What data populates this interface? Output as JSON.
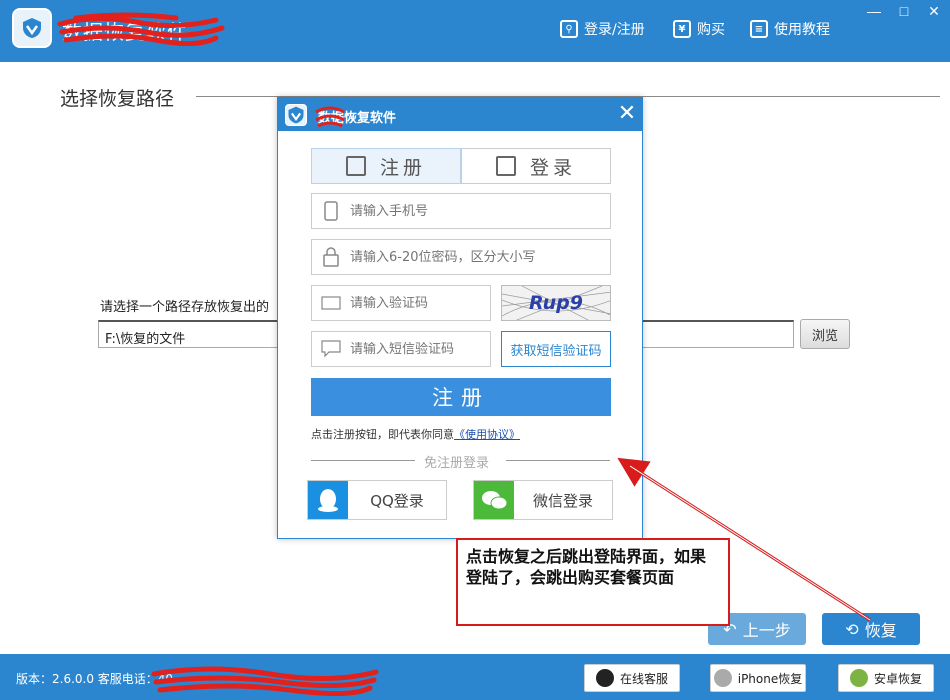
{
  "header": {
    "app_title": "数据恢复软件",
    "links": [
      {
        "label": "登录/注册",
        "icon": "user-key-icon"
      },
      {
        "label": "购买",
        "icon": "yen-icon"
      },
      {
        "label": "使用教程",
        "icon": "book-icon"
      }
    ],
    "window_controls": [
      "—",
      "□",
      "✕"
    ]
  },
  "main": {
    "section_title": "选择恢复路径",
    "path_label": "请选择一个路径存放恢复出的",
    "path_value": "F:\\恢复的文件",
    "browse_label": "浏览",
    "prev_label": "上一步",
    "recover_label": "恢复"
  },
  "footer": {
    "version_text": "版本：2.6.0.0 客服电话：40",
    "buttons": [
      {
        "label": "在线客服",
        "icon": "qq-icon"
      },
      {
        "label": "iPhone恢复",
        "icon": "apple-icon"
      },
      {
        "label": "安卓恢复",
        "icon": "android-icon"
      }
    ]
  },
  "dialog": {
    "title": "数据恢复软件",
    "tabs": [
      {
        "label": "注册",
        "icon": "edit-icon",
        "active": true
      },
      {
        "label": "登录",
        "icon": "login-icon",
        "active": false
      }
    ],
    "phone_placeholder": "请输入手机号",
    "password_placeholder": "请输入6-20位密码，区分大小写",
    "captcha_placeholder": "请输入验证码",
    "captcha_text": "Rup9",
    "sms_placeholder": "请输入短信验证码",
    "sms_button": "获取短信验证码",
    "register_button": "注册",
    "agreement_prefix": "点击注册按钮，即代表你同意",
    "agreement_link": "《使用协议》",
    "divider_text": "免注册登录",
    "qq_login": "QQ登录",
    "wechat_login": "微信登录"
  },
  "annotation": {
    "text": "点击恢复之后跳出登陆界面，如果登陆了，会跳出购买套餐页面"
  },
  "colors": {
    "primary_blue": "#2b86cf",
    "button_blue": "#3a8fde",
    "annotation_red": "#d81b1b",
    "qq_blue": "#1b8fe0",
    "wechat_green": "#4cb93a"
  }
}
